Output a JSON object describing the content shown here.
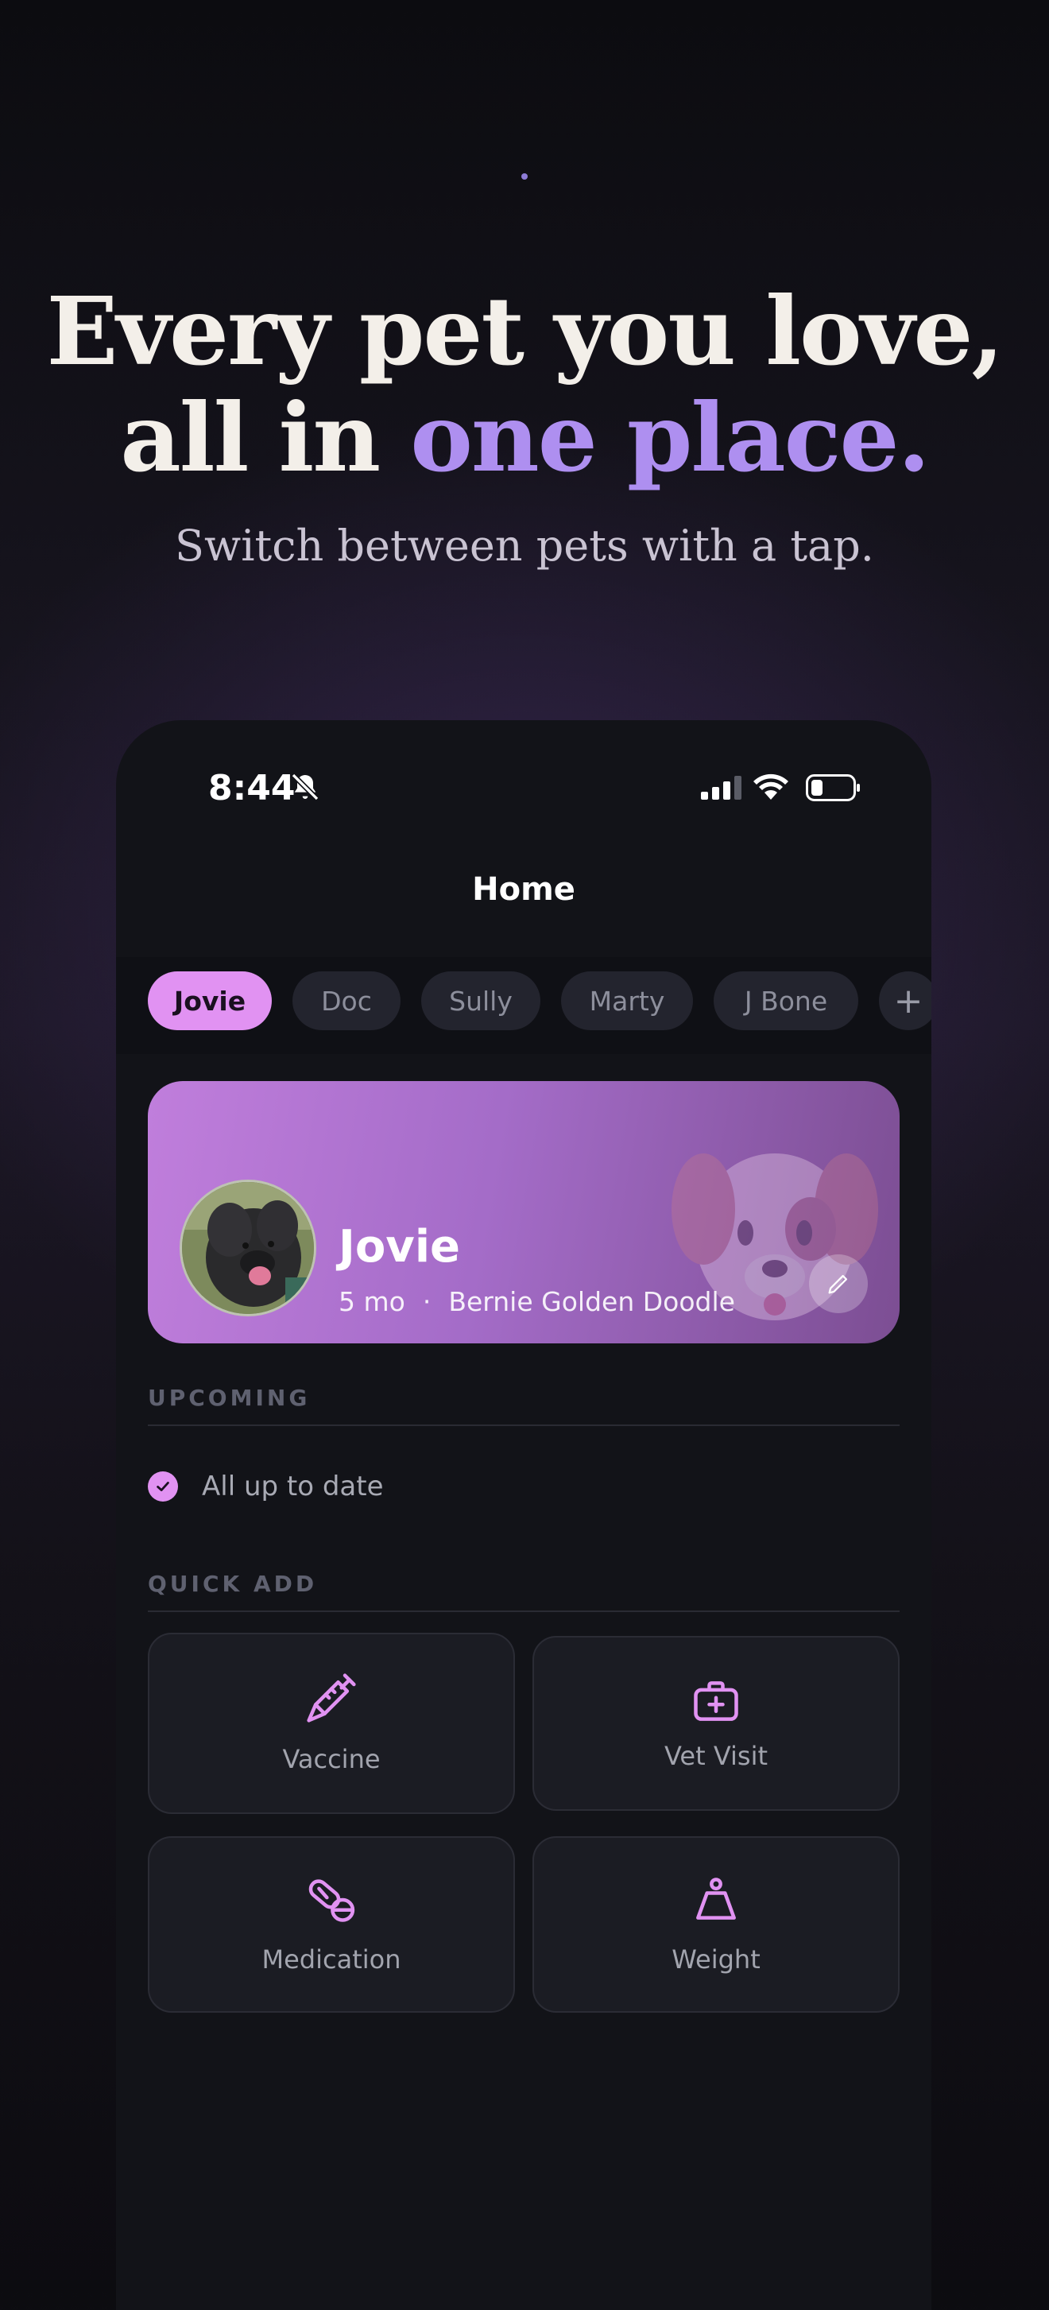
{
  "hero": {
    "line1": "Every pet you love,",
    "line2_prefix": "all in ",
    "line2_accent": "one place.",
    "subtitle": "Switch between pets with a tap."
  },
  "status_bar": {
    "time": "8:44"
  },
  "nav": {
    "title": "Home"
  },
  "pet_tabs": [
    "Jovie",
    "Doc",
    "Sully",
    "Marty",
    "J Bone"
  ],
  "add_tab_label": "+",
  "pet": {
    "name": "Jovie",
    "age": "5 mo",
    "separator": "·",
    "breed": "Bernie Golden Doodle"
  },
  "upcoming": {
    "label": "UPCOMING",
    "status": "All up to date"
  },
  "quick_add": {
    "label": "QUICK ADD",
    "items": [
      {
        "label": "Vaccine",
        "icon": "syringe-icon"
      },
      {
        "label": "Vet Visit",
        "icon": "medical-kit-icon"
      },
      {
        "label": "Medication",
        "icon": "pill-icon"
      },
      {
        "label": "Weight",
        "icon": "weight-icon"
      }
    ]
  },
  "colors": {
    "accent": "#e192f2",
    "headline_accent": "#ae8ff0",
    "background": "#121318"
  }
}
